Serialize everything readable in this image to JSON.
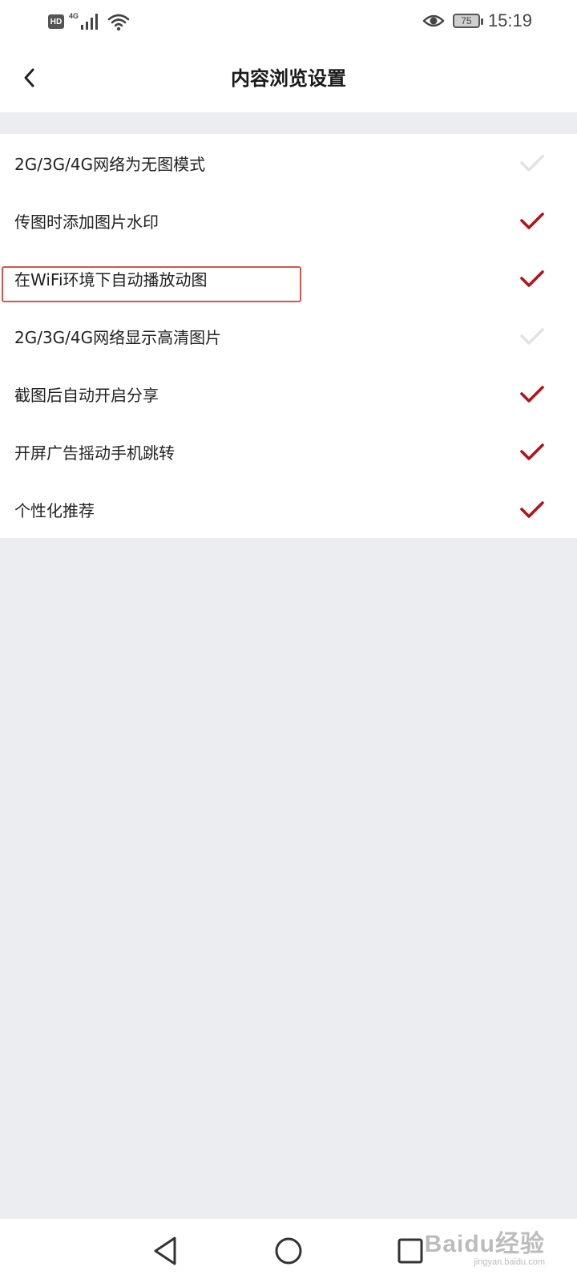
{
  "status_bar": {
    "hd_label": "HD",
    "network_label": "4G",
    "battery_level": "75",
    "time": "15:19",
    "icons": [
      "hd-icon",
      "signal-icon",
      "wifi-icon",
      "eye-icon",
      "battery-icon"
    ]
  },
  "header": {
    "back_icon": "chevron-left-icon",
    "title": "内容浏览设置"
  },
  "settings": {
    "items": [
      {
        "label": "2G/3G/4G网络为无图模式",
        "checked": false
      },
      {
        "label": "传图时添加图片水印",
        "checked": true
      },
      {
        "label": "在WiFi环境下自动播放动图",
        "checked": true,
        "highlighted": true
      },
      {
        "label": "2G/3G/4G网络显示高清图片",
        "checked": false
      },
      {
        "label": "截图后自动开启分享",
        "checked": true
      },
      {
        "label": "开屏广告摇动手机跳转",
        "checked": true
      },
      {
        "label": "个性化推荐",
        "checked": true
      }
    ]
  },
  "colors": {
    "check_on": "#b5121b",
    "check_off": "#e2e2e2",
    "highlight_box": "#d9534f",
    "page_background": "#ecedf0"
  },
  "nav_bar": {
    "icons": [
      "back-triangle-icon",
      "home-circle-icon",
      "recent-square-icon"
    ]
  },
  "watermark": {
    "main": "Baidu经验",
    "sub": "jingyan.baidu.com"
  }
}
